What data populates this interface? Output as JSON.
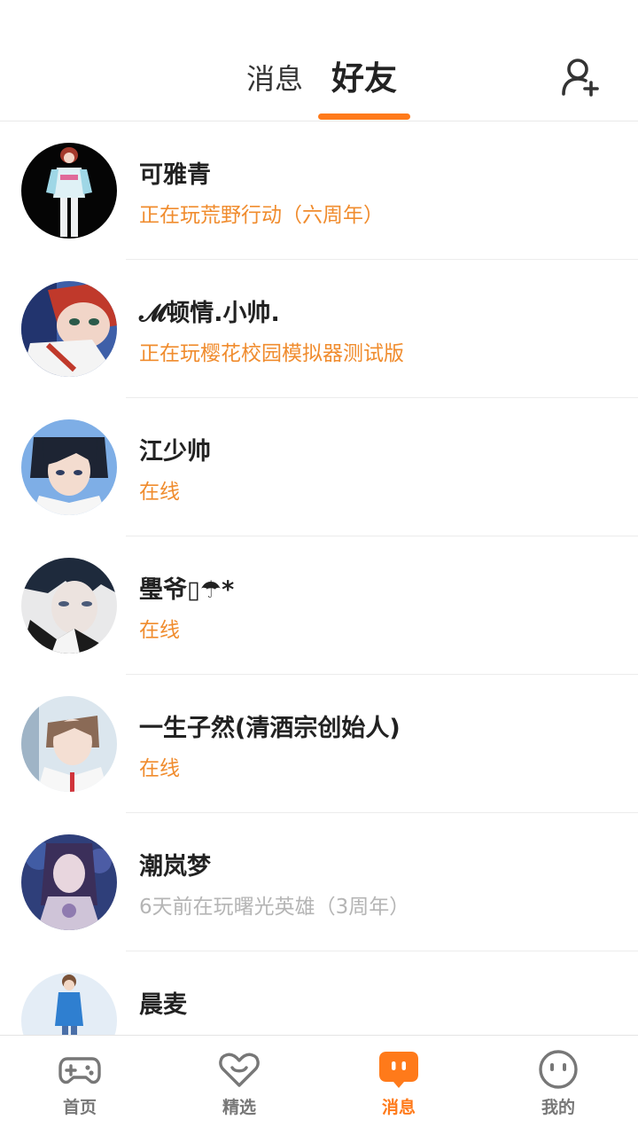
{
  "header": {
    "tabs": [
      {
        "label": "消息",
        "active": false
      },
      {
        "label": "好友",
        "active": true
      }
    ],
    "add_friend_icon": "add-user-icon"
  },
  "colors": {
    "accent": "#ff7a1a",
    "online": "#f08c2e",
    "offline": "#b5b5b5"
  },
  "friends": [
    {
      "name": "可雅青",
      "status": "正在玩荒野行动（六周年）",
      "state": "playing"
    },
    {
      "name": "𝓜顿情.小帅.",
      "status": "正在玩樱花校园模拟器测试版",
      "state": "playing"
    },
    {
      "name": "江少帅",
      "status": "在线",
      "state": "online"
    },
    {
      "name": "璺爷▯☂*",
      "status": "在线",
      "state": "online"
    },
    {
      "name": "一生子然(清酒宗创始人)",
      "status": "在线",
      "state": "online"
    },
    {
      "name": "潮岚梦",
      "status": "6天前在玩曙光英雄（3周年）",
      "state": "offline"
    },
    {
      "name": "晨麦",
      "status": "",
      "state": "offline"
    }
  ],
  "bottom_nav": [
    {
      "label": "首页",
      "icon": "gamepad-icon",
      "active": false
    },
    {
      "label": "精选",
      "icon": "heart-icon",
      "active": false
    },
    {
      "label": "消息",
      "icon": "chat-bubble-icon",
      "active": true
    },
    {
      "label": "我的",
      "icon": "smiley-face-icon",
      "active": false
    }
  ]
}
